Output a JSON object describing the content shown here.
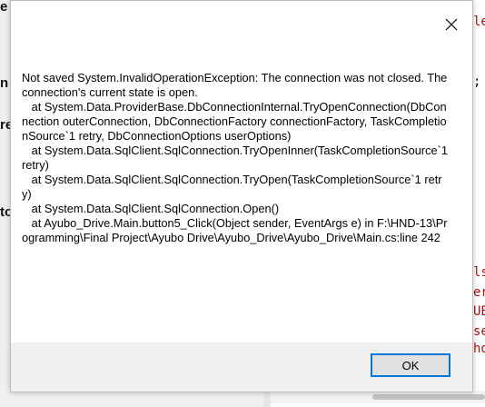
{
  "background": {
    "left_fragments": [
      "e",
      "n",
      "re",
      "to"
    ],
    "right_fragments": [
      {
        "text": "le",
        "color": "#a31515"
      },
      {
        "text": ";",
        "color": "#000000"
      },
      {
        "text": "ls",
        "color": "#a31515"
      },
      {
        "text": "er",
        "color": "#a31515"
      },
      {
        "text": "UE",
        "color": "#a31515"
      },
      {
        "text": "se",
        "color": "#a31515"
      },
      {
        "text": "ho",
        "color": "#a31515"
      }
    ]
  },
  "dialog": {
    "close_icon": "close-icon",
    "message": "Not saved System.InvalidOperationException: The connection was not closed. The connection's current state is open.\n   at System.Data.ProviderBase.DbConnectionInternal.TryOpenConnection(DbConnection outerConnection, DbConnectionFactory connectionFactory, TaskCompletionSource`1 retry, DbConnectionOptions userOptions)\n   at System.Data.SqlClient.SqlConnection.TryOpenInner(TaskCompletionSource`1 retry)\n   at System.Data.SqlClient.SqlConnection.TryOpen(TaskCompletionSource`1 retry)\n   at System.Data.SqlClient.SqlConnection.Open()\n   at Ayubo_Drive.Main.button5_Click(Object sender, EventArgs e) in F:\\HND-13\\Programming\\Final Project\\Ayubo Drive\\Ayubo_Drive\\Ayubo_Drive\\Main.cs:line 242",
    "ok_label": "OK",
    "accent": "#0078d7"
  }
}
